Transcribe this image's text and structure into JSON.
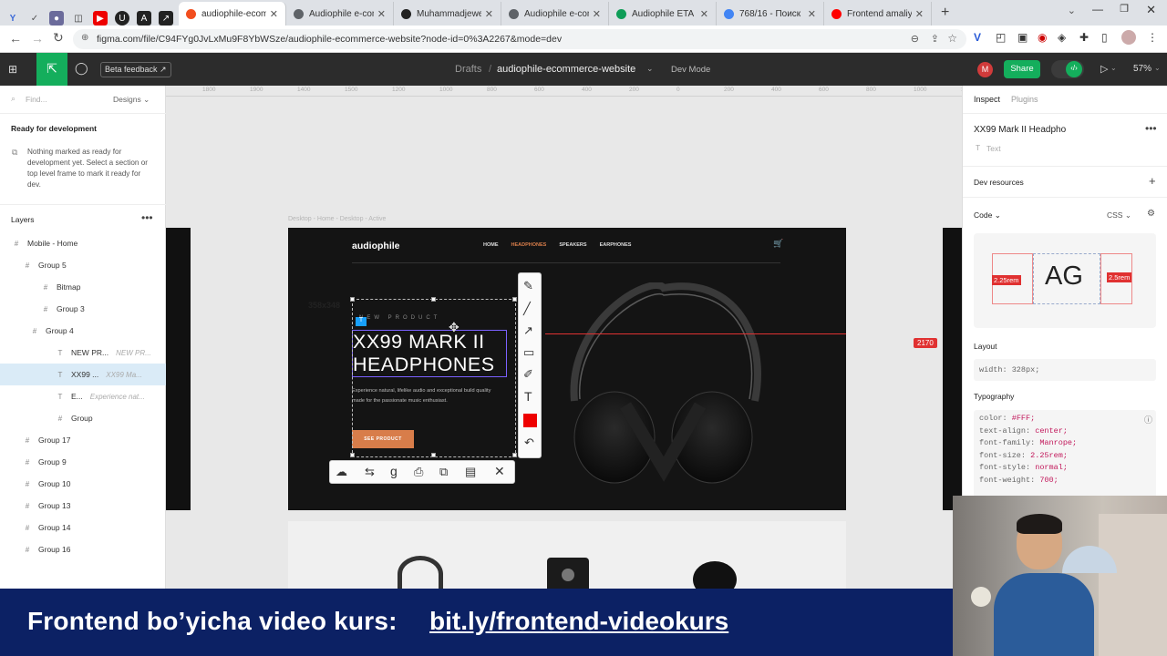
{
  "browser": {
    "tabs": [
      {
        "label": "audiophile-ecomm",
        "color": "#f24e1e",
        "active": true
      },
      {
        "label": "Audiophile e-com",
        "color": "#5f6368"
      },
      {
        "label": "Muhammadjewel",
        "color": "#222222"
      },
      {
        "label": "Audiophile e-com",
        "color": "#5f6368"
      },
      {
        "label": "Audiophile ETA",
        "color": "#0f9d58"
      },
      {
        "label": "768/16 - Поиск",
        "color": "#4285f4"
      },
      {
        "label": "Frontend amaliy",
        "color": "#ff0000"
      }
    ],
    "url": "figma.com/file/C94FYg0JvLxMu9F8YbWSze/audiophile-ecommerce-website?node-id=0%3A2267&mode=dev"
  },
  "figma_toolbar": {
    "beta_label": "Beta feedback",
    "breadcrumb_root": "Drafts",
    "file_name": "audiophile-ecommerce-website",
    "mode": "Dev Mode",
    "avatar_initial": "M",
    "share_label": "Share",
    "zoom": "57%"
  },
  "left_panel": {
    "search_placeholder": "Find...",
    "designs_label": "Designs",
    "ready_title": "Ready for development",
    "ready_desc": "Nothing marked as ready for development yet. Select a section or top level frame to mark it ready for dev.",
    "layers_title": "Layers",
    "layers": [
      {
        "label": "Mobile - Home",
        "icon": "#",
        "sub": ""
      },
      {
        "label": "Group 5",
        "icon": "#",
        "sub": ""
      },
      {
        "label": "Bitmap",
        "icon": "#",
        "sub": ""
      },
      {
        "label": "Group 3",
        "icon": "#",
        "sub": ""
      },
      {
        "label": "Group 4",
        "icon": "#",
        "sub": ""
      },
      {
        "label": "NEW PR...",
        "icon": "T",
        "sub": "NEW PR..."
      },
      {
        "label": "XX99 ...",
        "icon": "T",
        "sub": "XX99 Ma...",
        "selected": true
      },
      {
        "label": "E...",
        "icon": "T",
        "sub": "Experience nat..."
      },
      {
        "label": "Group",
        "icon": "#",
        "sub": ""
      },
      {
        "label": "Group 17",
        "icon": "#",
        "sub": ""
      },
      {
        "label": "Group 9",
        "icon": "#",
        "sub": ""
      },
      {
        "label": "Group 10",
        "icon": "#",
        "sub": ""
      },
      {
        "label": "Group 13",
        "icon": "#",
        "sub": ""
      },
      {
        "label": "Group 14",
        "icon": "#",
        "sub": ""
      },
      {
        "label": "Group 16",
        "icon": "#",
        "sub": ""
      }
    ]
  },
  "canvas": {
    "ruler": [
      "1800",
      "1900",
      "1400",
      "1500",
      "1200",
      "1000",
      "800",
      "600",
      "400",
      "200",
      "0",
      "200",
      "400",
      "600",
      "800",
      "1000",
      "10"
    ],
    "frame_label": "Desktop - Home - Desktop - Active",
    "site": {
      "logo": "audiophile",
      "nav": [
        "HOME",
        "HEADPHONES",
        "SPEAKERS",
        "EARPHONES"
      ],
      "overline": "NEW PRODUCT",
      "title_line1": "XX99 MARK II",
      "title_line2": "HEADPHONES",
      "description": "Experience natural, lifelike audio and exceptional build quality made for the passionate music enthusiast.",
      "cta": "SEE PRODUCT"
    },
    "size_label": "358x348",
    "distance_label": "2170",
    "text_badge": "T"
  },
  "right_panel": {
    "tabs": [
      "Inspect",
      "Plugins"
    ],
    "layer_name": "XX99 Mark II Headpho",
    "layer_type": "Text",
    "dev_resources": "Dev resources",
    "code_label": "Code",
    "code_lang": "CSS",
    "preview_text": "AG",
    "left_measure": "2.25rem",
    "right_measure": "2.5rem",
    "layout_title": "Layout",
    "layout_code": "width: 328px;",
    "typography_title": "Typography",
    "typography": [
      {
        "prop": "color:",
        "val": "#FFF;"
      },
      {
        "prop": "text-align:",
        "val": "center;"
      },
      {
        "prop": "font-family:",
        "val": "Manrope;"
      },
      {
        "prop": "font-size:",
        "val": "2.25rem;"
      },
      {
        "prop": "font-style:",
        "val": "normal;"
      },
      {
        "prop": "font-weight:",
        "val": "700;"
      }
    ]
  },
  "banner": {
    "text": "Frontend bo’yicha video kurs:",
    "link": "bit.ly/frontend-videokurs"
  },
  "colors": {
    "accent": "#d87d4a",
    "figma_green": "#14ae5c",
    "measure_red": "#e03131",
    "banner_blue": "#0c2164"
  }
}
